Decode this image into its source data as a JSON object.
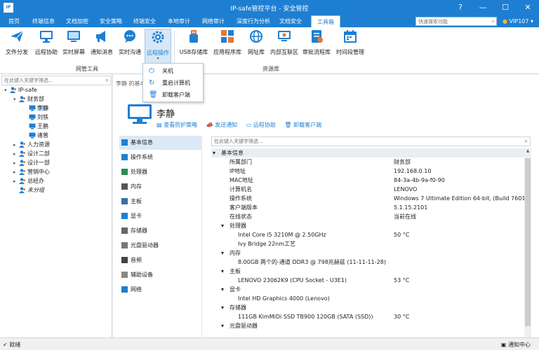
{
  "window": {
    "logo_text": "IP",
    "title": "IP-safe管控平台 - 安全管控",
    "buttons": [
      "?",
      "—",
      "☐",
      "✕"
    ]
  },
  "menubar": {
    "items": [
      "首页",
      "终端信息",
      "文档加密",
      "安全策略",
      "终端安全",
      "本地审计",
      "网络审计",
      "深度行为分析",
      "文档安全",
      "工具箱"
    ],
    "active_index": 9,
    "search_placeholder": "快速搜索功能",
    "vip_label": "VIP107",
    "vip_caret": "▾"
  },
  "ribbon": {
    "buttons": [
      {
        "label": "文件分发",
        "icon": "paper-plane-icon"
      },
      {
        "label": "远程协助",
        "icon": "monitor-icon"
      },
      {
        "label": "实时屏幕",
        "icon": "screen-icon"
      },
      {
        "label": "通知消息",
        "icon": "megaphone-icon"
      },
      {
        "label": "实时沟通",
        "icon": "chat-icon"
      },
      {
        "label": "远程操作",
        "icon": "gear-icon",
        "caret": "▾"
      },
      {
        "label": "USB存储库",
        "icon": "usb-icon"
      },
      {
        "label": "应用程序库",
        "icon": "apps-icon"
      },
      {
        "label": "网址库",
        "icon": "globe-icon"
      },
      {
        "label": "内部互联区",
        "icon": "network-icon"
      },
      {
        "label": "审批流程库",
        "icon": "approval-icon"
      },
      {
        "label": "时间段管理",
        "icon": "calendar-icon"
      }
    ],
    "groups": [
      "网管工具",
      "资源库"
    ]
  },
  "dropdown": {
    "items": [
      {
        "label": "关机",
        "icon": "power-icon",
        "glyph": "⏻"
      },
      {
        "label": "重启计算机",
        "icon": "restart-icon",
        "glyph": "↻"
      },
      {
        "label": "卸载客户端",
        "icon": "trash-icon",
        "glyph": "🗑"
      }
    ]
  },
  "tree": {
    "filter_placeholder": "在此键入关键字筛选...",
    "nodes": [
      {
        "label": "IP-safe",
        "expand": "▾",
        "italic": false
      },
      {
        "label": "财务部",
        "expand": "▾",
        "italic": false
      },
      {
        "label": "李静",
        "expand": "",
        "italic": false,
        "selected": true
      },
      {
        "label": "刘铁",
        "expand": "",
        "italic": false
      },
      {
        "label": "王鹏",
        "expand": "",
        "italic": false
      },
      {
        "label": "诸普",
        "expand": "",
        "italic": false
      },
      {
        "label": "人力资源",
        "expand": "▸",
        "italic": false
      },
      {
        "label": "设计二部",
        "expand": "▸",
        "italic": false
      },
      {
        "label": "设计一部",
        "expand": "▸",
        "italic": false
      },
      {
        "label": "营销中心",
        "expand": "▸",
        "italic": false
      },
      {
        "label": "总经办",
        "expand": "▸",
        "italic": false
      },
      {
        "label": "未分组",
        "expand": "",
        "italic": true
      }
    ]
  },
  "main": {
    "breadcrumb": "李静 的基本",
    "user_name": "李静",
    "actions": [
      "查看防护策略",
      "发送通知",
      "远程协助",
      "卸载客户端"
    ],
    "nav": [
      "基本信息",
      "操作系统",
      "处理器",
      "内存",
      "主板",
      "显卡",
      "存储器",
      "光盘驱动器",
      "音频",
      "辅助设备",
      "网络"
    ],
    "nav_active": 0,
    "detail_filter_placeholder": "在此键入关键字筛选...",
    "rows": [
      {
        "type": "cat",
        "key": "基本信息",
        "value": ""
      },
      {
        "type": "item",
        "key": "所属部门",
        "value": "财务部"
      },
      {
        "type": "item",
        "key": "IP地址",
        "value": "192.168.0.10"
      },
      {
        "type": "item",
        "key": "MAC地址",
        "value": "84-3a-4b-9a-f0-90"
      },
      {
        "type": "item",
        "key": "计算机名",
        "value": "LENOVO"
      },
      {
        "type": "item",
        "key": "操作系统",
        "value": "Windows 7 Ultimate Edition 64-bit, (Build 7601)"
      },
      {
        "type": "item",
        "key": "客户端版本",
        "value": "5.1.15.2101"
      },
      {
        "type": "item",
        "key": "在线状态",
        "value": "当前在线"
      },
      {
        "type": "sub",
        "key": "处理器",
        "value": ""
      },
      {
        "type": "item2",
        "key": "Intel Core i5 3210M @ 2.50GHz",
        "value": "50 °C"
      },
      {
        "type": "item2",
        "key": "Ivy Bridge 22nm工艺",
        "value": ""
      },
      {
        "type": "sub",
        "key": "内存",
        "value": ""
      },
      {
        "type": "item2",
        "key": "8.00GB 两个的-通道 DDR3 @ 798兆赫兹 (11-11-11-28)",
        "value": ""
      },
      {
        "type": "sub",
        "key": "主板",
        "value": ""
      },
      {
        "type": "item2",
        "key": "LENOVO 23062K9 (CPU Socket - U3E1)",
        "value": "53 °C"
      },
      {
        "type": "sub",
        "key": "显卡",
        "value": ""
      },
      {
        "type": "item2",
        "key": "Intel HD Graphics 4000 (Lenovo)",
        "value": ""
      },
      {
        "type": "sub",
        "key": "存储器",
        "value": ""
      },
      {
        "type": "item2",
        "key": "111GB KimMiDi SSD TB900 120GB (SATA (SSD))",
        "value": "30 °C"
      },
      {
        "type": "sub",
        "key": "光盘驱动器",
        "value": ""
      }
    ]
  },
  "statusbar": {
    "left": "就绪",
    "right": "通知中心"
  },
  "colors": {
    "accent": "#1e7fd2",
    "icon_orange": "#e8752e"
  }
}
